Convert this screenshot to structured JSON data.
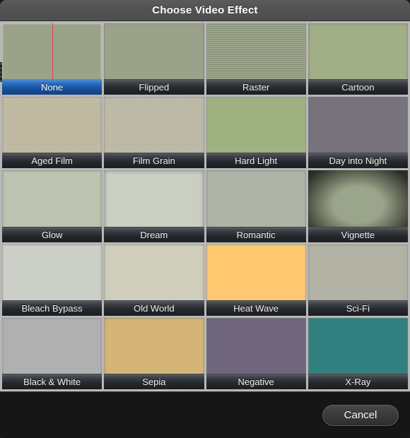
{
  "dialog": {
    "title": "Choose Video Effect"
  },
  "grid": {
    "columns": 4,
    "rows": 5,
    "selected_index": 0,
    "selected_label": "None",
    "selection_color": "#1b5bab",
    "label_bar_color": "#26292d",
    "playhead_color": "#e04a4a",
    "effects": [
      {
        "label": "None",
        "fx": "fx-none",
        "overlay": "none"
      },
      {
        "label": "Flipped",
        "fx": "fx-flipped",
        "overlay": "none"
      },
      {
        "label": "Raster",
        "fx": "fx-raster",
        "overlay": "raster"
      },
      {
        "label": "Cartoon",
        "fx": "fx-cartoon",
        "overlay": "none"
      },
      {
        "label": "Aged Film",
        "fx": "fx-agedfilm",
        "overlay": "grain"
      },
      {
        "label": "Film Grain",
        "fx": "fx-filmgrain",
        "overlay": "grain"
      },
      {
        "label": "Hard Light",
        "fx": "fx-hardlight",
        "overlay": "none"
      },
      {
        "label": "Day into Night",
        "fx": "fx-daynight",
        "overlay": "none"
      },
      {
        "label": "Glow",
        "fx": "fx-glow",
        "overlay": "none"
      },
      {
        "label": "Dream",
        "fx": "fx-dream",
        "overlay": "none"
      },
      {
        "label": "Romantic",
        "fx": "fx-romantic",
        "overlay": "none"
      },
      {
        "label": "Vignette",
        "fx": "fx-vignette",
        "overlay": "vignette"
      },
      {
        "label": "Bleach Bypass",
        "fx": "fx-bleach",
        "overlay": "none"
      },
      {
        "label": "Old World",
        "fx": "fx-oldworld",
        "overlay": "none"
      },
      {
        "label": "Heat Wave",
        "fx": "fx-heatwave",
        "overlay": "none"
      },
      {
        "label": "Sci-Fi",
        "fx": "fx-scifi",
        "overlay": "none"
      },
      {
        "label": "Black & White",
        "fx": "fx-bw",
        "overlay": "none"
      },
      {
        "label": "Sepia",
        "fx": "fx-sepia",
        "overlay": "none"
      },
      {
        "label": "Negative",
        "fx": "fx-negative",
        "overlay": "none"
      },
      {
        "label": "X-Ray",
        "fx": "fx-xray",
        "overlay": "none"
      }
    ]
  },
  "footer": {
    "cancel_label": "Cancel"
  }
}
